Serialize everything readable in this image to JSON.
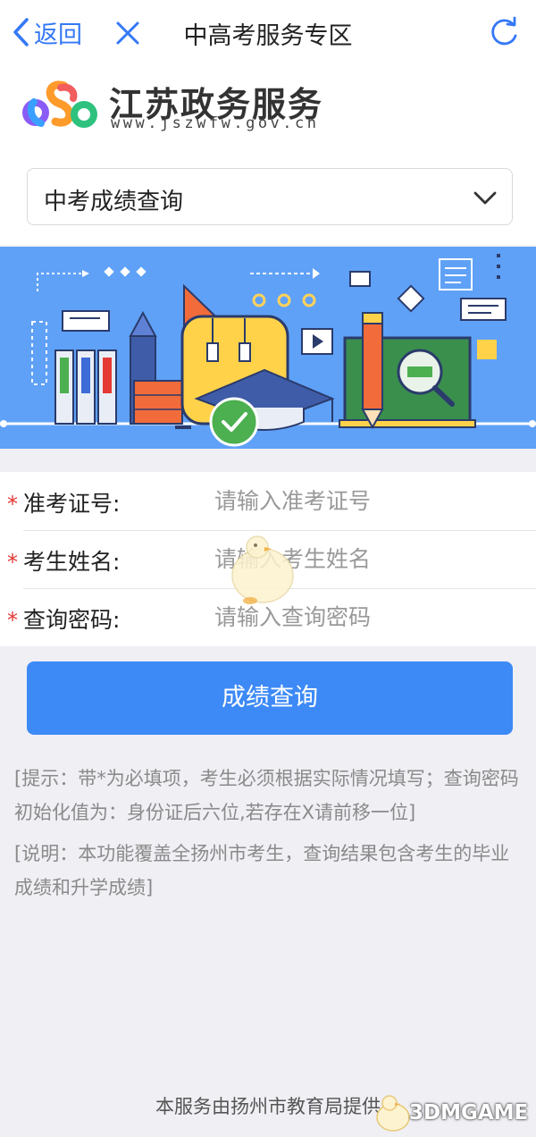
{
  "nav": {
    "back_label": "返回",
    "title": "中高考服务专区"
  },
  "logo": {
    "name": "江苏政务服务",
    "url": "www.jszwfw.gov.cn"
  },
  "query_select": {
    "selected": "中考成绩查询"
  },
  "form": {
    "required_mark": "*",
    "fields": [
      {
        "label": "准考证号:",
        "placeholder": "请输入准考证号",
        "value": ""
      },
      {
        "label": "考生姓名:",
        "placeholder": "请输入考生姓名",
        "value": ""
      },
      {
        "label": "查询密码:",
        "placeholder": "请输入查询密码",
        "value": ""
      }
    ]
  },
  "submit_label": "成绩查询",
  "notes": {
    "tip": "[提示：带*为必填项，考生必须根据实际情况填写；查询密码初始化值为：身份证后六位,若存在X请前移一位]",
    "description": "[说明：本功能覆盖全扬州市考生，查询结果包含考生的毕业成绩和升学成绩]"
  },
  "footer": "本服务由扬州市教育局提供",
  "watermark": "3DMGAME",
  "colors": {
    "accent": "#3d8af7",
    "nav_blue": "#3478f6",
    "banner_bg": "#5fa1f7",
    "required": "#e53935",
    "note_text": "#8a8a8a"
  },
  "icons": {
    "back": "chevron-left-icon",
    "close": "close-icon",
    "refresh": "refresh-icon",
    "dropdown": "chevron-down-icon"
  }
}
